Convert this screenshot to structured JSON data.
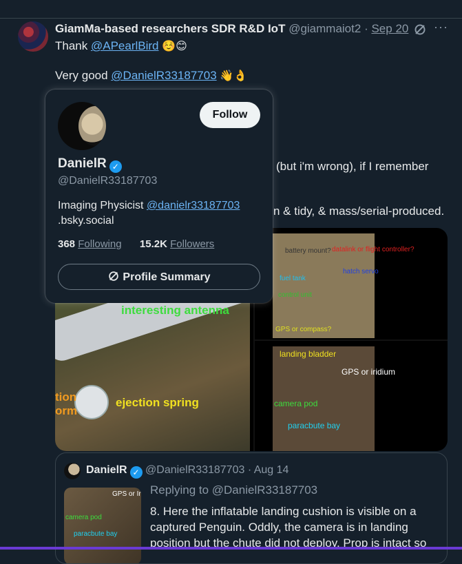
{
  "post": {
    "author_name": "GiamMa-based researchers SDR R&D IoT",
    "author_handle": "@giammaiot2",
    "separator": "·",
    "date": "Sep 20",
    "line1_prefix": "Thank ",
    "line1_mention": "@APearlBird",
    "line1_emoji": "☺️😊",
    "line2_prefix": "Very good ",
    "line2_mention": "@DanielR33187703",
    "line2_emoji": "👋👌",
    "partial_line3": "(but i'm wrong), if I remember",
    "partial_line4": "n & tidy, & mass/serial-produced."
  },
  "media": {
    "left_labels": [
      "interesting antenna",
      "ejection spring",
      "tion",
      "orm"
    ],
    "top_right_labels": [
      "battery mount?",
      "datalink or flight controller?",
      "hatch servo",
      "fuel tank",
      "control unit",
      "GPS or compass?"
    ],
    "bottom_right_labels": [
      "landing bladder",
      "GPS or iridium",
      "camera pod",
      "paracbute bay"
    ]
  },
  "hover_card": {
    "name": "DanielR",
    "handle": "@DanielR33187703",
    "bio_prefix": "Imaging Physicist ",
    "bio_link": "@danielr33187703",
    "bio_suffix": ".bsky.social",
    "following_count": "368",
    "following_label": "Following",
    "followers_count": "15.2K",
    "followers_label": "Followers",
    "follow_label": "Follow",
    "summary_label": "Profile Summary"
  },
  "quote": {
    "name": "DanielR",
    "handle": "@DanielR33187703",
    "date": "Aug 14",
    "replying": "Replying to @DanielR33187703",
    "text_lines": [
      "8. Here the inflatable landing cushion is visible on a",
      "captured Penguin. Oddly, the camera is in landing",
      "position but the chute did not deploy. Prop is intact so"
    ],
    "thumb_labels": [
      "GPS or Iridium",
      "camera pod",
      "paracbute bay"
    ]
  },
  "icons": [
    "grok-icon",
    "more-icon",
    "verified-icon",
    "summary-icon"
  ],
  "colors": {
    "accent": "#1d9bf0",
    "background": "#15202b",
    "link": "#6cb4f5"
  }
}
